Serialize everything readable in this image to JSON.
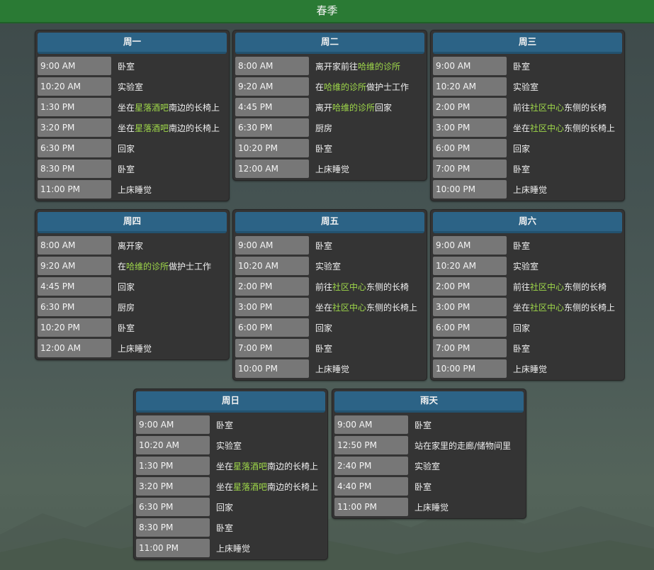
{
  "header": {
    "title": "春季"
  },
  "colors": {
    "header": "#2a7a34",
    "card_head": "#2c6386",
    "time_cell": "#777777",
    "highlight": "#9fd84a"
  },
  "days": [
    {
      "name": "周一",
      "entries": [
        {
          "time": "9:00 AM",
          "loc": [
            [
              "卧室",
              false
            ]
          ]
        },
        {
          "time": "10:20 AM",
          "loc": [
            [
              "实验室",
              false
            ]
          ]
        },
        {
          "time": "1:30 PM",
          "loc": [
            [
              "坐在",
              false
            ],
            [
              "星落酒吧",
              true
            ],
            [
              "南边的长椅上",
              false
            ]
          ]
        },
        {
          "time": "3:20 PM",
          "loc": [
            [
              "坐在",
              false
            ],
            [
              "星落酒吧",
              true
            ],
            [
              "南边的长椅上",
              false
            ]
          ]
        },
        {
          "time": "6:30 PM",
          "loc": [
            [
              "回家",
              false
            ]
          ]
        },
        {
          "time": "8:30 PM",
          "loc": [
            [
              "卧室",
              false
            ]
          ]
        },
        {
          "time": "11:00 PM",
          "loc": [
            [
              "上床睡觉",
              false
            ]
          ]
        }
      ]
    },
    {
      "name": "周二",
      "entries": [
        {
          "time": "8:00 AM",
          "loc": [
            [
              "离开家前往",
              false
            ],
            [
              "哈维的诊所",
              true
            ]
          ]
        },
        {
          "time": "9:20 AM",
          "loc": [
            [
              "在",
              false
            ],
            [
              "哈维的诊所",
              true
            ],
            [
              "做护士工作",
              false
            ]
          ]
        },
        {
          "time": "4:45 PM",
          "loc": [
            [
              "离开",
              false
            ],
            [
              "哈维的诊所",
              true
            ],
            [
              "回家",
              false
            ]
          ]
        },
        {
          "time": "6:30 PM",
          "loc": [
            [
              "厨房",
              false
            ]
          ]
        },
        {
          "time": "10:20 PM",
          "loc": [
            [
              "卧室",
              false
            ]
          ]
        },
        {
          "time": "12:00 AM",
          "loc": [
            [
              "上床睡觉",
              false
            ]
          ]
        }
      ]
    },
    {
      "name": "周三",
      "entries": [
        {
          "time": "9:00 AM",
          "loc": [
            [
              "卧室",
              false
            ]
          ]
        },
        {
          "time": "10:20 AM",
          "loc": [
            [
              "实验室",
              false
            ]
          ]
        },
        {
          "time": "2:00 PM",
          "loc": [
            [
              "前往",
              false
            ],
            [
              "社区中心",
              true
            ],
            [
              "东侧的长椅",
              false
            ]
          ]
        },
        {
          "time": "3:00 PM",
          "loc": [
            [
              "坐在",
              false
            ],
            [
              "社区中心",
              true
            ],
            [
              "东侧的长椅上",
              false
            ]
          ]
        },
        {
          "time": "6:00 PM",
          "loc": [
            [
              "回家",
              false
            ]
          ]
        },
        {
          "time": "7:00 PM",
          "loc": [
            [
              "卧室",
              false
            ]
          ]
        },
        {
          "time": "10:00 PM",
          "loc": [
            [
              "上床睡觉",
              false
            ]
          ]
        }
      ]
    },
    {
      "name": "周四",
      "entries": [
        {
          "time": "8:00 AM",
          "loc": [
            [
              "离开家",
              false
            ]
          ]
        },
        {
          "time": "9:20 AM",
          "loc": [
            [
              "在",
              false
            ],
            [
              "哈维的诊所",
              true
            ],
            [
              "做护士工作",
              false
            ]
          ]
        },
        {
          "time": "4:45 PM",
          "loc": [
            [
              "回家",
              false
            ]
          ]
        },
        {
          "time": "6:30 PM",
          "loc": [
            [
              "厨房",
              false
            ]
          ]
        },
        {
          "time": "10:20 PM",
          "loc": [
            [
              "卧室",
              false
            ]
          ]
        },
        {
          "time": "12:00 AM",
          "loc": [
            [
              "上床睡觉",
              false
            ]
          ]
        }
      ]
    },
    {
      "name": "周五",
      "entries": [
        {
          "time": "9:00 AM",
          "loc": [
            [
              "卧室",
              false
            ]
          ]
        },
        {
          "time": "10:20 AM",
          "loc": [
            [
              "实验室",
              false
            ]
          ]
        },
        {
          "time": "2:00 PM",
          "loc": [
            [
              "前往",
              false
            ],
            [
              "社区中心",
              true
            ],
            [
              "东侧的长椅",
              false
            ]
          ]
        },
        {
          "time": "3:00 PM",
          "loc": [
            [
              "坐在",
              false
            ],
            [
              "社区中心",
              true
            ],
            [
              "东侧的长椅上",
              false
            ]
          ]
        },
        {
          "time": "6:00 PM",
          "loc": [
            [
              "回家",
              false
            ]
          ]
        },
        {
          "time": "7:00 PM",
          "loc": [
            [
              "卧室",
              false
            ]
          ]
        },
        {
          "time": "10:00 PM",
          "loc": [
            [
              "上床睡觉",
              false
            ]
          ]
        }
      ]
    },
    {
      "name": "周六",
      "entries": [
        {
          "time": "9:00 AM",
          "loc": [
            [
              "卧室",
              false
            ]
          ]
        },
        {
          "time": "10:20 AM",
          "loc": [
            [
              "实验室",
              false
            ]
          ]
        },
        {
          "time": "2:00 PM",
          "loc": [
            [
              "前往",
              false
            ],
            [
              "社区中心",
              true
            ],
            [
              "东侧的长椅",
              false
            ]
          ]
        },
        {
          "time": "3:00 PM",
          "loc": [
            [
              "坐在",
              false
            ],
            [
              "社区中心",
              true
            ],
            [
              "东侧的长椅上",
              false
            ]
          ]
        },
        {
          "time": "6:00 PM",
          "loc": [
            [
              "回家",
              false
            ]
          ]
        },
        {
          "time": "7:00 PM",
          "loc": [
            [
              "卧室",
              false
            ]
          ]
        },
        {
          "time": "10:00 PM",
          "loc": [
            [
              "上床睡觉",
              false
            ]
          ]
        }
      ]
    },
    {
      "name": "周日",
      "entries": [
        {
          "time": "9:00 AM",
          "loc": [
            [
              "卧室",
              false
            ]
          ]
        },
        {
          "time": "10:20 AM",
          "loc": [
            [
              "实验室",
              false
            ]
          ]
        },
        {
          "time": "1:30 PM",
          "loc": [
            [
              "坐在",
              false
            ],
            [
              "星落酒吧",
              true
            ],
            [
              "南边的长椅上",
              false
            ]
          ]
        },
        {
          "time": "3:20 PM",
          "loc": [
            [
              "坐在",
              false
            ],
            [
              "星落酒吧",
              true
            ],
            [
              "南边的长椅上",
              false
            ]
          ]
        },
        {
          "time": "6:30 PM",
          "loc": [
            [
              "回家",
              false
            ]
          ]
        },
        {
          "time": "8:30 PM",
          "loc": [
            [
              "卧室",
              false
            ]
          ]
        },
        {
          "time": "11:00 PM",
          "loc": [
            [
              "上床睡觉",
              false
            ]
          ]
        }
      ]
    },
    {
      "name": "雨天",
      "entries": [
        {
          "time": "9:00 AM",
          "loc": [
            [
              "卧室",
              false
            ]
          ]
        },
        {
          "time": "12:50 PM",
          "loc": [
            [
              "站在家里的走廊/储物间里",
              false
            ]
          ]
        },
        {
          "time": "2:40 PM",
          "loc": [
            [
              "实验室",
              false
            ]
          ]
        },
        {
          "time": "4:40 PM",
          "loc": [
            [
              "卧室",
              false
            ]
          ]
        },
        {
          "time": "11:00 PM",
          "loc": [
            [
              "上床睡觉",
              false
            ]
          ]
        }
      ]
    }
  ]
}
